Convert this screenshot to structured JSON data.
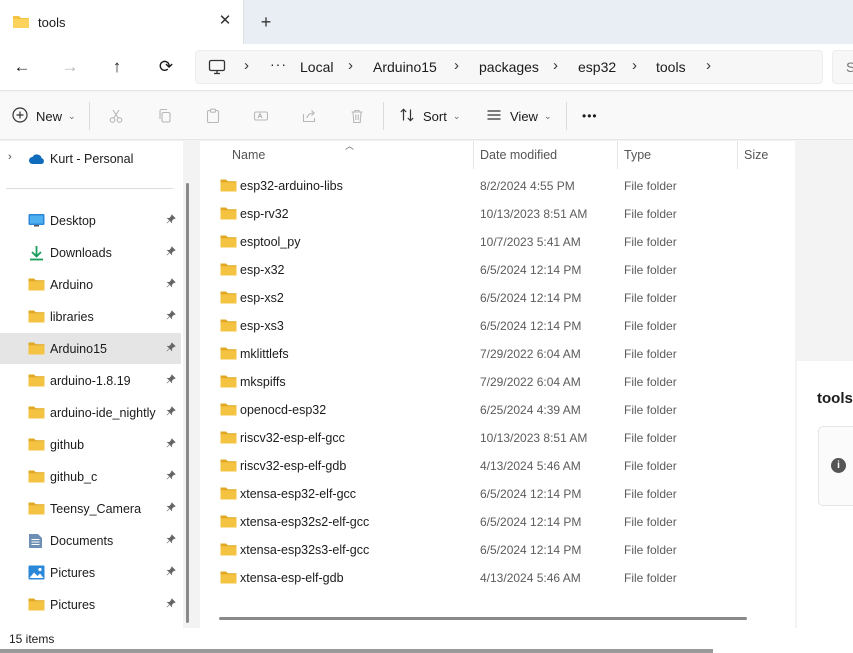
{
  "window": {
    "tab_title": "tools",
    "close_glyph": "✕",
    "new_tab_glyph": "+"
  },
  "nav": {
    "back_glyph": "←",
    "forward_glyph": "→",
    "up_glyph": "↑",
    "refresh_glyph": "⟳",
    "overflow_glyph": "···",
    "crumbs": [
      "Local",
      "Arduino15",
      "packages",
      "esp32",
      "tools"
    ],
    "search_glyph": "S"
  },
  "toolbar": {
    "new_label": "New",
    "sort_label": "Sort",
    "view_label": "View",
    "more_glyph": "•••"
  },
  "sidebar": {
    "top_item": "Kurt - Personal",
    "items": [
      {
        "label": "Desktop",
        "icon": "desktop-icon"
      },
      {
        "label": "Downloads",
        "icon": "download-icon"
      },
      {
        "label": "Arduino",
        "icon": "folder-icon"
      },
      {
        "label": "libraries",
        "icon": "folder-icon"
      },
      {
        "label": "Arduino15",
        "icon": "folder-icon",
        "selected": true
      },
      {
        "label": "arduino-1.8.19",
        "icon": "folder-icon"
      },
      {
        "label": "arduino-ide_nightly",
        "icon": "folder-icon"
      },
      {
        "label": "github",
        "icon": "folder-icon"
      },
      {
        "label": "github_c",
        "icon": "folder-icon"
      },
      {
        "label": "Teensy_Camera",
        "icon": "folder-icon"
      },
      {
        "label": "Documents",
        "icon": "documents-icon"
      },
      {
        "label": "Pictures",
        "icon": "pictures-icon"
      },
      {
        "label": "Pictures",
        "icon": "folder-icon"
      }
    ]
  },
  "columns": {
    "name": "Name",
    "date": "Date modified",
    "type": "Type",
    "size": "Size"
  },
  "files": [
    {
      "name": "esp32-arduino-libs",
      "date": "8/2/2024 4:55 PM",
      "type": "File folder"
    },
    {
      "name": "esp-rv32",
      "date": "10/13/2023 8:51 AM",
      "type": "File folder"
    },
    {
      "name": "esptool_py",
      "date": "10/7/2023 5:41 AM",
      "type": "File folder"
    },
    {
      "name": "esp-x32",
      "date": "6/5/2024 12:14 PM",
      "type": "File folder"
    },
    {
      "name": "esp-xs2",
      "date": "6/5/2024 12:14 PM",
      "type": "File folder"
    },
    {
      "name": "esp-xs3",
      "date": "6/5/2024 12:14 PM",
      "type": "File folder"
    },
    {
      "name": "mklittlefs",
      "date": "7/29/2022 6:04 AM",
      "type": "File folder"
    },
    {
      "name": "mkspiffs",
      "date": "7/29/2022 6:04 AM",
      "type": "File folder"
    },
    {
      "name": "openocd-esp32",
      "date": "6/25/2024 4:39 AM",
      "type": "File folder"
    },
    {
      "name": "riscv32-esp-elf-gcc",
      "date": "10/13/2023 8:51 AM",
      "type": "File folder"
    },
    {
      "name": "riscv32-esp-elf-gdb",
      "date": "4/13/2024 5:46 AM",
      "type": "File folder"
    },
    {
      "name": "xtensa-esp32-elf-gcc",
      "date": "6/5/2024 12:14 PM",
      "type": "File folder"
    },
    {
      "name": "xtensa-esp32s2-elf-gcc",
      "date": "6/5/2024 12:14 PM",
      "type": "File folder"
    },
    {
      "name": "xtensa-esp32s3-elf-gcc",
      "date": "6/5/2024 12:14 PM",
      "type": "File folder"
    },
    {
      "name": "xtensa-esp-elf-gdb",
      "date": "4/13/2024 5:46 AM",
      "type": "File folder"
    }
  ],
  "details": {
    "title": "tools",
    "info_glyph": "i"
  },
  "status": {
    "item_count": "15 items"
  },
  "colors": {
    "folder": "#f5c342",
    "folder_dark": "#e0a823",
    "selected_bg": "#e5e5e5",
    "accent": "#0067c0"
  }
}
